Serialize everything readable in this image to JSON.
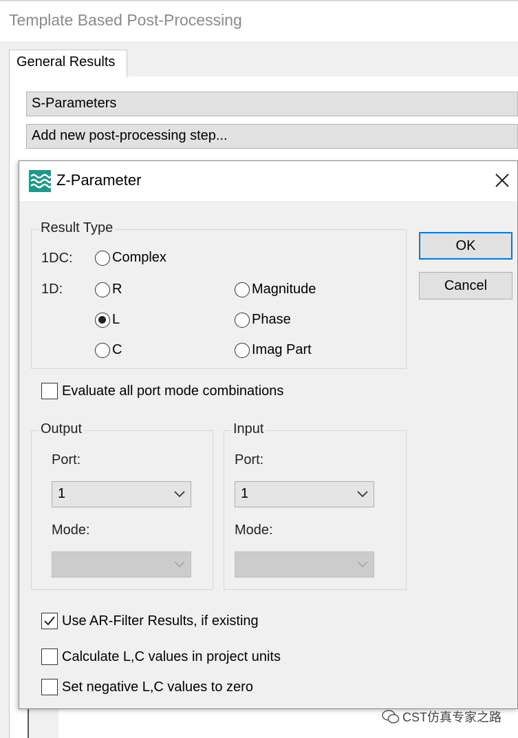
{
  "background": {
    "window_title": "Template Based Post-Processing",
    "tab_label": "General Results",
    "bars": [
      "S-Parameters",
      "Add new post-processing step..."
    ]
  },
  "dialog": {
    "title": "Z-Parameter",
    "icon": "cst-app-icon",
    "result_type": {
      "group_label": "Result Type",
      "label_1dc": "1DC:",
      "label_1d": "1D:",
      "options": {
        "complex": "Complex",
        "r": "R",
        "l": "L",
        "c": "C",
        "magnitude": "Magnitude",
        "phase": "Phase",
        "imag_part": "Imag Part"
      },
      "selected": "L"
    },
    "evaluate_all_ports": {
      "label": "Evaluate all port mode combinations",
      "checked": false
    },
    "output": {
      "group_label": "Output",
      "port_label": "Port:",
      "port_value": "1",
      "mode_label": "Mode:",
      "mode_value": ""
    },
    "input": {
      "group_label": "Input",
      "port_label": "Port:",
      "port_value": "1",
      "mode_label": "Mode:",
      "mode_value": ""
    },
    "ar_filter": {
      "label": "Use AR-Filter Results, if existing",
      "checked": true
    },
    "project_units": {
      "label": "Calculate L,C values in project units",
      "checked": false
    },
    "negative_zero": {
      "label": "Set negative L,C values to zero",
      "checked": false
    },
    "buttons": {
      "ok": "OK",
      "cancel": "Cancel"
    }
  },
  "watermark": "CST仿真专家之路",
  "colors": {
    "accent": "#0078d7",
    "icon_teal": "#1a9a8a"
  }
}
